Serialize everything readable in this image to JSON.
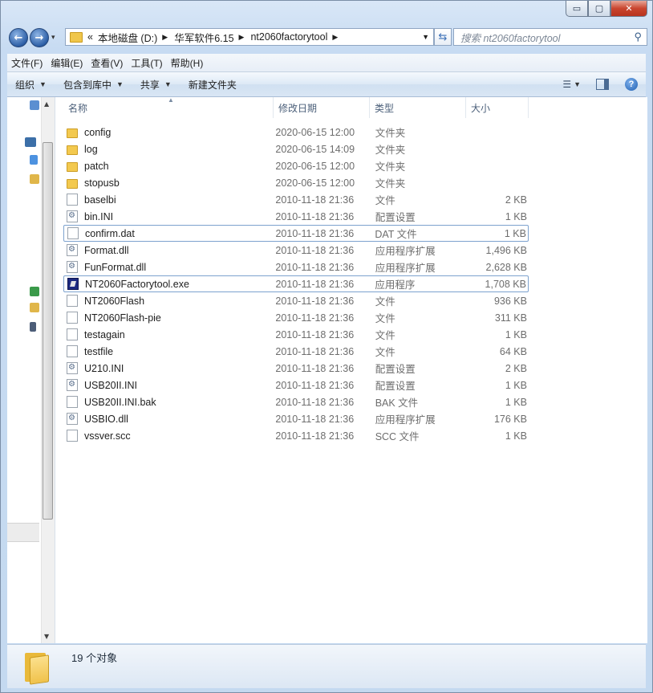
{
  "window": {
    "caption_buttons": {
      "minimize": "▭",
      "maximize": "▢",
      "close": "✕"
    }
  },
  "navigation": {
    "back_icon": "←",
    "forward_icon": "→",
    "dropdown_icon": "▾",
    "address": {
      "overflow": "«",
      "crumbs": [
        "本地磁盘 (D:)",
        "华军软件6.15",
        "nt2060factorytool"
      ]
    },
    "search_placeholder": "搜索 nt2060factorytool"
  },
  "menubar": [
    "文件(F)",
    "编辑(E)",
    "查看(V)",
    "工具(T)",
    "帮助(H)"
  ],
  "toolbar": {
    "organize": "组织",
    "include_in_library": "包含到库中",
    "share": "共享",
    "new_folder": "新建文件夹"
  },
  "columns": {
    "name": "名称",
    "date": "修改日期",
    "type": "类型",
    "size": "大小"
  },
  "files": [
    {
      "name": "config",
      "date": "2020-06-15 12:00",
      "type": "文件夹",
      "size": "",
      "icon": "folder-icon"
    },
    {
      "name": "log",
      "date": "2020-06-15 14:09",
      "type": "文件夹",
      "size": "",
      "icon": "folder-icon"
    },
    {
      "name": "patch",
      "date": "2020-06-15 12:00",
      "type": "文件夹",
      "size": "",
      "icon": "folder-icon"
    },
    {
      "name": "stopusb",
      "date": "2020-06-15 12:00",
      "type": "文件夹",
      "size": "",
      "icon": "folder-icon"
    },
    {
      "name": "baselbi",
      "date": "2010-11-18 21:36",
      "type": "文件",
      "size": "2 KB",
      "icon": "file-icon"
    },
    {
      "name": "bin.INI",
      "date": "2010-11-18 21:36",
      "type": "配置设置",
      "size": "1 KB",
      "icon": "settings-file-icon"
    },
    {
      "name": "confirm.dat",
      "date": "2010-11-18 21:36",
      "type": "DAT 文件",
      "size": "1 KB",
      "icon": "file-icon",
      "selected": true
    },
    {
      "name": "Format.dll",
      "date": "2010-11-18 21:36",
      "type": "应用程序扩展",
      "size": "1,496 KB",
      "icon": "settings-file-icon"
    },
    {
      "name": "FunFormat.dll",
      "date": "2010-11-18 21:36",
      "type": "应用程序扩展",
      "size": "2,628 KB",
      "icon": "settings-file-icon"
    },
    {
      "name": "NT2060Factorytool.exe",
      "date": "2010-11-18 21:36",
      "type": "应用程序",
      "size": "1,708 KB",
      "icon": "exe-icon",
      "selected": true
    },
    {
      "name": "NT2060Flash",
      "date": "2010-11-18 21:36",
      "type": "文件",
      "size": "936 KB",
      "icon": "file-icon"
    },
    {
      "name": "NT2060Flash-pie",
      "date": "2010-11-18 21:36",
      "type": "文件",
      "size": "311 KB",
      "icon": "file-icon"
    },
    {
      "name": "testagain",
      "date": "2010-11-18 21:36",
      "type": "文件",
      "size": "1 KB",
      "icon": "file-icon"
    },
    {
      "name": "testfile",
      "date": "2010-11-18 21:36",
      "type": "文件",
      "size": "64 KB",
      "icon": "file-icon"
    },
    {
      "name": "U210.INI",
      "date": "2010-11-18 21:36",
      "type": "配置设置",
      "size": "2 KB",
      "icon": "settings-file-icon"
    },
    {
      "name": "USB20II.INI",
      "date": "2010-11-18 21:36",
      "type": "配置设置",
      "size": "1 KB",
      "icon": "settings-file-icon"
    },
    {
      "name": "USB20II.INI.bak",
      "date": "2010-11-18 21:36",
      "type": "BAK 文件",
      "size": "1 KB",
      "icon": "file-icon"
    },
    {
      "name": "USBIO.dll",
      "date": "2010-11-18 21:36",
      "type": "应用程序扩展",
      "size": "176 KB",
      "icon": "settings-file-icon"
    },
    {
      "name": "vssver.scc",
      "date": "2010-11-18 21:36",
      "type": "SCC 文件",
      "size": "1 KB",
      "icon": "file-icon"
    }
  ],
  "status": {
    "count_text": "19 个对象"
  }
}
